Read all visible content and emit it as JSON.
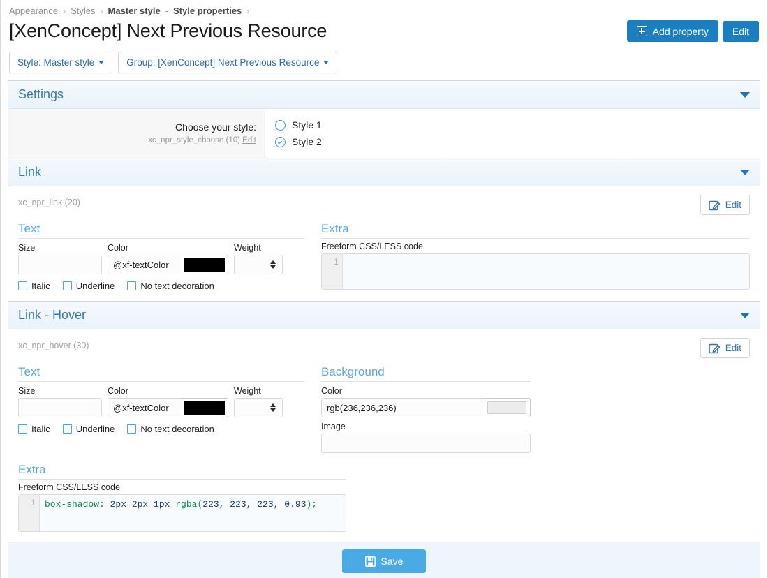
{
  "breadcrumb": {
    "items": [
      "Appearance",
      "Styles"
    ],
    "master_style": "Master style",
    "dash": "-",
    "style_properties": "Style properties",
    "separator": "›"
  },
  "header": {
    "title": "[XenConcept] Next Previous Resource",
    "add_property_label": "Add property",
    "edit_label": "Edit"
  },
  "filters": {
    "style_pill": "Style: Master style",
    "group_pill": "Group: [XenConcept] Next Previous Resource"
  },
  "settings": {
    "section_title": "Settings",
    "choose_label": "Choose your style:",
    "choose_hint_key": "xc_npr_style_choose (10)",
    "choose_hint_edit": "Edit",
    "options": [
      {
        "label": "Style 1",
        "checked": false
      },
      {
        "label": "Style 2",
        "checked": true
      }
    ]
  },
  "link": {
    "section_title": "Link",
    "prop_key": "xc_npr_link (20)",
    "edit_label": "Edit",
    "text_group_title": "Text",
    "size_label": "Size",
    "size_value": "",
    "color_label": "Color",
    "color_value": "@xf-textColor",
    "color_swatch": "#000000",
    "weight_label": "Weight",
    "weight_value": "",
    "checkboxes": [
      {
        "label": "Italic",
        "checked": false
      },
      {
        "label": "Underline",
        "checked": false
      },
      {
        "label": "No text decoration",
        "checked": false
      }
    ],
    "extra_group_title": "Extra",
    "code_label": "Freeform CSS/LESS code",
    "code_line_number": "1",
    "code_value": ""
  },
  "link_hover": {
    "section_title": "Link - Hover",
    "prop_key": "xc_npr_hover (30)",
    "edit_label": "Edit",
    "text_group_title": "Text",
    "size_label": "Size",
    "size_value": "",
    "color_label": "Color",
    "color_value": "@xf-textColor",
    "color_swatch": "#000000",
    "weight_label": "Weight",
    "weight_value": "",
    "checkboxes": [
      {
        "label": "Italic",
        "checked": false
      },
      {
        "label": "Underline",
        "checked": false
      },
      {
        "label": "No text decoration",
        "checked": false
      }
    ],
    "background_group_title": "Background",
    "bg_color_label": "Color",
    "bg_color_value": "rgb(236,236,236)",
    "bg_color_swatch": "#ececec",
    "bg_image_label": "Image",
    "bg_image_value": "",
    "extra_group_title": "Extra",
    "code_label": "Freeform CSS/LESS code",
    "code_line_number": "1",
    "code_tokens": {
      "property": "box-shadow",
      "colon": ":",
      "values": " 2px 2px 1px ",
      "fn_open": "rgba(",
      "fn_args": "223, 223, 223, 0.93",
      "fn_close": ");"
    }
  },
  "footer": {
    "save_label": "Save"
  },
  "colors": {
    "accent_blue": "#1b7ec1",
    "save_blue": "#4aaae6",
    "section_title_blue": "#3b7aa8",
    "sub_title_blue": "#63a5d1",
    "link_blue": "#2d6ca2"
  }
}
